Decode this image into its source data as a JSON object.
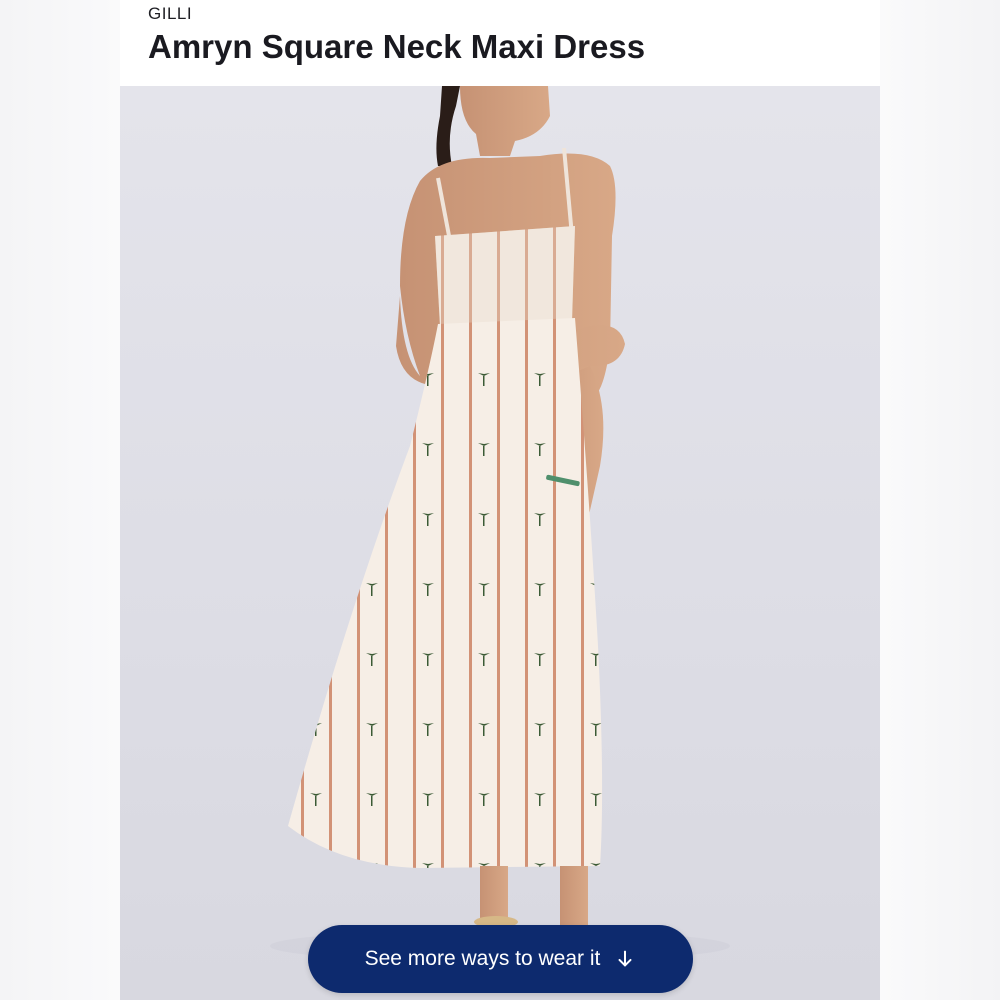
{
  "product": {
    "brand": "GILLI",
    "title": "Amryn Square Neck Maxi Dress"
  },
  "cta": {
    "label": "See more ways to wear it",
    "icon": "arrow-down-icon"
  },
  "colors": {
    "cta_background": "#0d2a6e",
    "photo_background": "#dddde5",
    "dress_base": "#f6eee6",
    "dress_stripe": "#c97b5a",
    "palm_print": "#3b5a35"
  }
}
